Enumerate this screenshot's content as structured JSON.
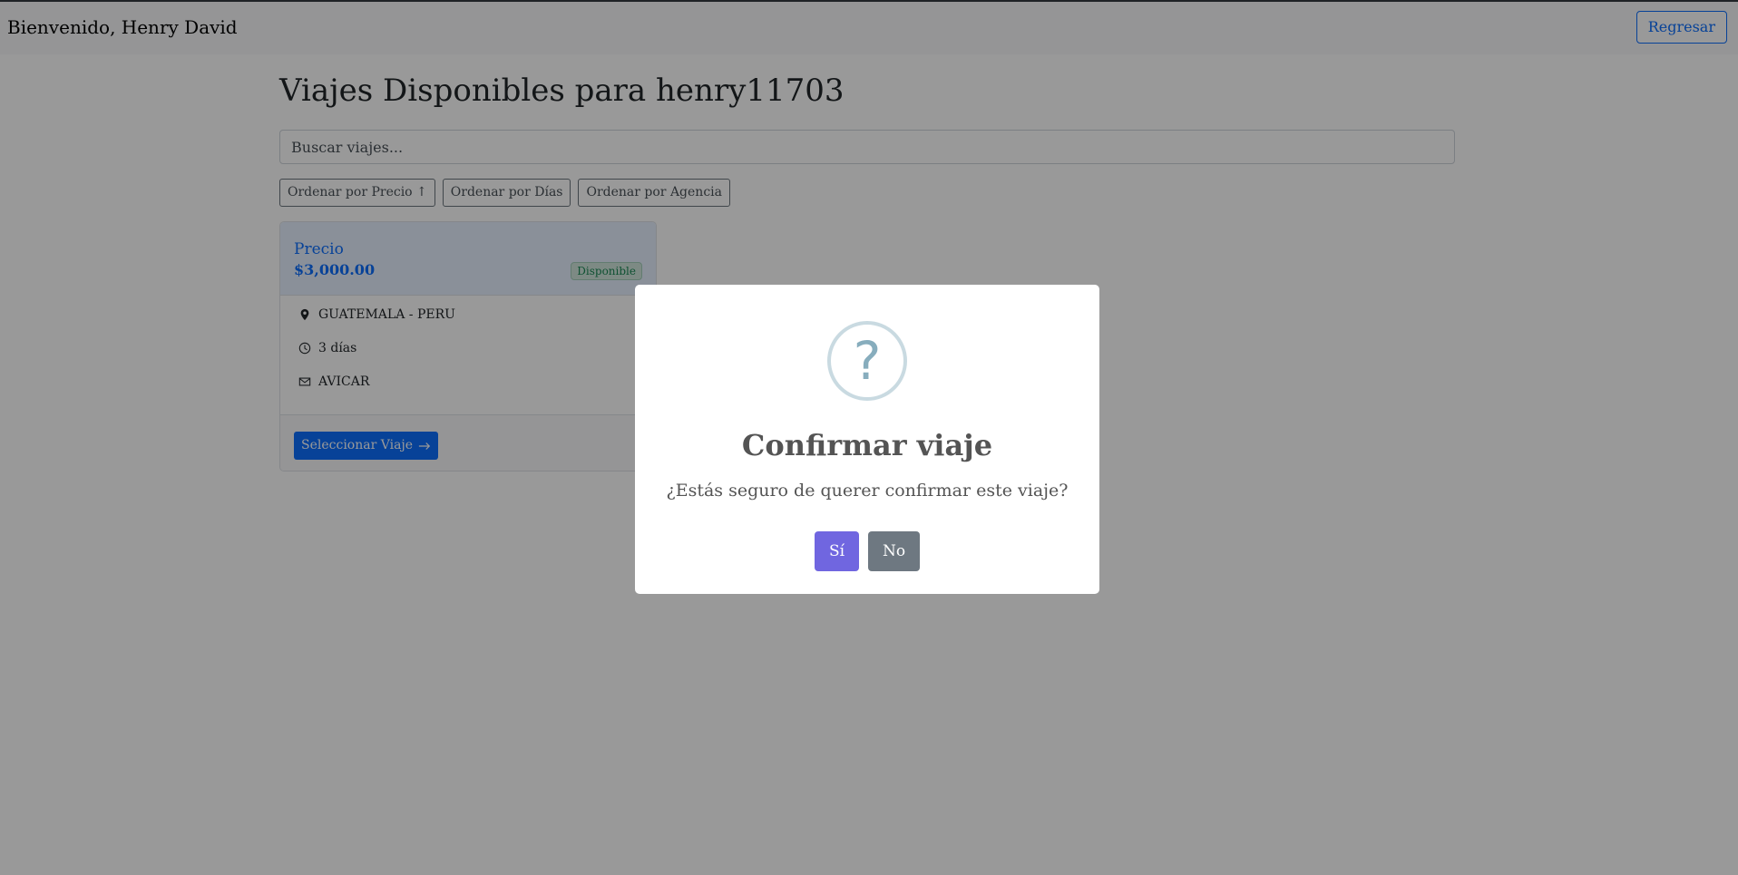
{
  "header": {
    "welcome": "Bienvenido, Henry David",
    "back_label": "Regresar"
  },
  "main": {
    "title": "Viajes Disponibles para henry11703",
    "search_placeholder": "Buscar viajes...",
    "sort_buttons": [
      "Ordenar por Precio ↑",
      "Ordenar por Días",
      "Ordenar por Agencia"
    ]
  },
  "trip_card": {
    "price_label": "Precio",
    "price_value": "$3,000.00",
    "status": "Disponible",
    "route": "GUATEMALA - PERU",
    "duration": "3 días",
    "agency": "AVICAR",
    "select_label": "Seleccionar Viaje",
    "icons": [
      "location-pin-icon",
      "clock-icon",
      "envelope-icon",
      "arrow-right-icon"
    ]
  },
  "dialog": {
    "icon": "?",
    "title": "Confirmar viaje",
    "message": "¿Estás seguro de querer confirmar este viaje?",
    "confirm_label": "Sí",
    "cancel_label": "No"
  },
  "colors": {
    "primary": "#0d6efd",
    "confirm": "#7066e0",
    "cancel": "#6e7881",
    "success": "#198754"
  }
}
